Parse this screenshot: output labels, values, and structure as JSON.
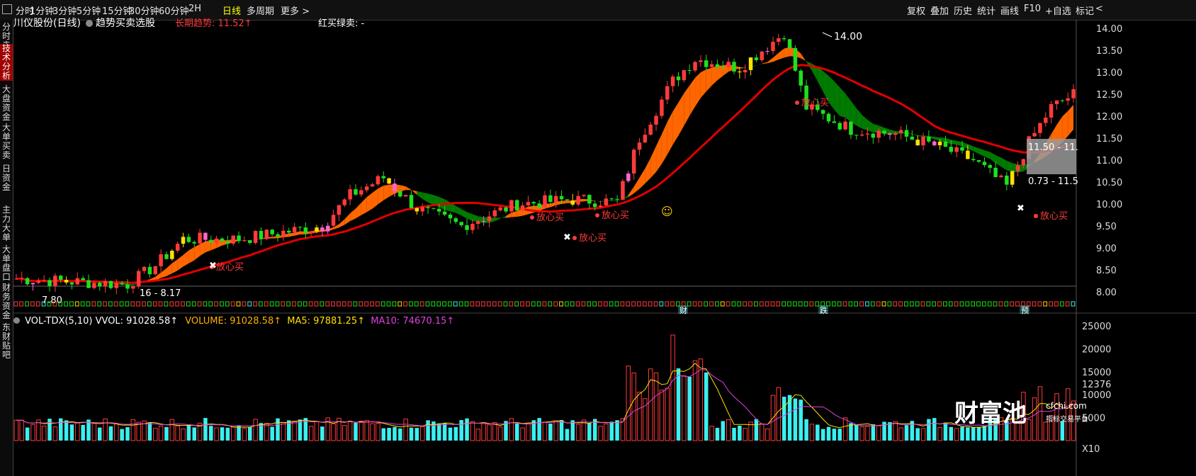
{
  "toolbar": {
    "left_items": [
      "分时",
      "1分钟",
      "3分钟",
      "5分钟",
      "15分钟",
      "30分钟",
      "60分钟",
      "2H",
      "日线",
      "多周期",
      "更多 >"
    ],
    "active_index": 8,
    "right_items": [
      "复权",
      "叠加",
      "历史",
      "统计",
      "画线",
      "F10",
      "+自选",
      "标记",
      "<"
    ]
  },
  "sidebar": {
    "tabs": [
      "分时走势",
      "技术分析",
      "大盘资金",
      "大单买卖",
      "日资金",
      "主力大单",
      "大单盘口",
      "财务资金",
      "东财贴吧"
    ],
    "active_index": 1
  },
  "header": {
    "title": "川仪股份(日线)",
    "indicator": "趋势买卖选股",
    "long_trend": "长期趋势: 11.52↑",
    "red_buy": "红买绿卖: -"
  },
  "annotations": {
    "high_price": "14.00",
    "range_1": "11.50 - 11.",
    "range_2": "0.73 - 11.5",
    "low_left": "16 - 8.17",
    "low_left2": "7.80",
    "buy_label": "放心买",
    "events": [
      "财",
      "跌",
      "预"
    ],
    "emoji": "☺"
  },
  "volume_header": {
    "name": "VOL-TDX(5,10)",
    "vvol": "VVOL: 91028.58↑",
    "volume": "VOLUME: 91028.58↑",
    "ma5": "MA5: 97881.25↑",
    "ma10": "MA10: 74670.15↑"
  },
  "price_axis": [
    "14.00",
    "13.50",
    "13.00",
    "12.50",
    "12.00",
    "11.50",
    "11.00",
    "10.50",
    "10.00",
    "9.50",
    "9.00",
    "8.50",
    "8.00"
  ],
  "volume_axis": [
    "25000",
    "20000",
    "15000",
    "12376",
    "10000",
    "5000",
    "X10"
  ],
  "watermark": {
    "brand": "财富池",
    "site": "cfchi.com",
    "tagline": "指标交易平台"
  },
  "colors": {
    "up": "#ff3b3b",
    "down": "#1ee01e",
    "yellow": "#ffe000",
    "pink": "#ff66cc",
    "cyan": "#3af0f0",
    "orange": "#ff6600",
    "green_band": "#007a00",
    "ma_red": "#e00000",
    "accent": "#ffff00"
  },
  "chart_data": {
    "type": "candlestick",
    "title": "川仪股份(日线)",
    "price_range": [
      8.0,
      14.0
    ],
    "note_high": 14.0,
    "candles_ohlc_sample": [
      [
        8.3,
        8.35,
        8.15,
        8.2
      ],
      [
        8.2,
        8.25,
        8.1,
        8.17
      ],
      [
        8.17,
        8.5,
        8.16,
        8.45
      ],
      [
        8.45,
        8.8,
        8.4,
        8.75
      ],
      [
        8.75,
        9.3,
        8.7,
        9.2
      ],
      [
        9.2,
        9.4,
        9.0,
        9.1
      ],
      [
        9.1,
        9.3,
        9.0,
        9.25
      ],
      [
        9.25,
        9.5,
        9.2,
        9.4
      ],
      [
        9.4,
        9.6,
        9.3,
        9.55
      ],
      [
        9.55,
        10.3,
        9.5,
        10.2
      ],
      [
        10.2,
        10.8,
        10.1,
        10.4
      ],
      [
        10.4,
        10.5,
        9.9,
        10.0
      ],
      [
        10.0,
        10.1,
        9.4,
        9.5
      ],
      [
        9.5,
        9.7,
        9.4,
        9.65
      ],
      [
        9.65,
        10.0,
        9.6,
        9.9
      ],
      [
        9.9,
        10.2,
        9.8,
        10.1
      ],
      [
        10.1,
        10.2,
        9.9,
        10.0
      ],
      [
        10.0,
        11.8,
        10.0,
        11.6
      ],
      [
        11.6,
        12.8,
        11.5,
        12.6
      ],
      [
        12.6,
        13.5,
        12.4,
        13.3
      ],
      [
        13.3,
        13.4,
        12.9,
        13.0
      ],
      [
        13.0,
        13.1,
        12.6,
        12.7
      ],
      [
        12.7,
        14.0,
        12.6,
        13.9
      ],
      [
        13.9,
        13.9,
        12.3,
        12.4
      ],
      [
        12.4,
        12.5,
        11.6,
        11.7
      ],
      [
        11.7,
        12.0,
        11.5,
        11.9
      ],
      [
        11.9,
        12.0,
        11.6,
        11.7
      ],
      [
        11.7,
        11.8,
        11.2,
        11.3
      ],
      [
        11.3,
        11.4,
        10.9,
        11.0
      ],
      [
        11.0,
        11.1,
        10.3,
        10.4
      ],
      [
        10.4,
        11.6,
        10.3,
        11.5
      ],
      [
        11.5,
        12.3,
        11.4,
        12.2
      ],
      [
        12.2,
        12.6,
        12.1,
        12.5
      ]
    ],
    "volume_range": [
      0,
      25000
    ]
  }
}
